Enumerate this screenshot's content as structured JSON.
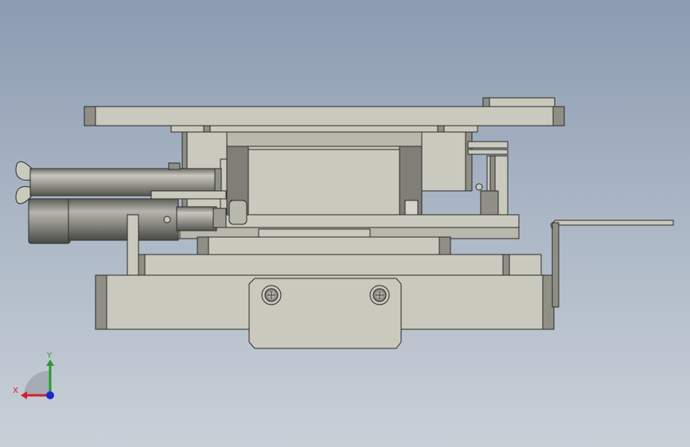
{
  "viewport": {
    "background_top": "#8c9bb1",
    "background_bottom": "#c9d0d8",
    "part_fill": "#c9c9bd",
    "part_shade": "#8f8f86",
    "edge_color": "#2b2b2b"
  },
  "triad": {
    "x_label": "X",
    "y_label": "Y",
    "x_color": "#d0202a",
    "y_color": "#2a9a2a",
    "z_color": "#1a2ad0"
  }
}
